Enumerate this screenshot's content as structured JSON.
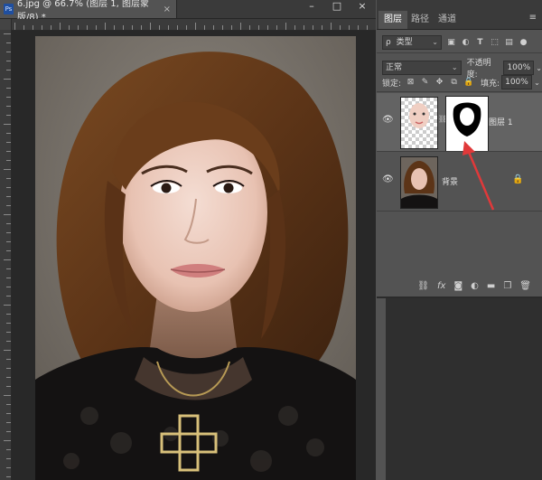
{
  "document": {
    "tab_title": "6.jpg @ 66.7% (图层 1, 图层蒙版/8) *",
    "ps_badge": "Ps",
    "close_glyph": "×"
  },
  "window": {
    "minimize": "–",
    "maximize": "□",
    "close": "×"
  },
  "panel": {
    "tabs": [
      {
        "label": "图层",
        "active": true
      },
      {
        "label": "路径",
        "active": false
      },
      {
        "label": "通道",
        "active": false
      }
    ],
    "menu_glyph": "≡",
    "filter": {
      "search_glyph": "ρ",
      "kind_label": "类型"
    },
    "filter_icons": [
      "image-filter-icon",
      "adjustment-filter-icon",
      "type-filter-icon",
      "shape-filter-icon",
      "smartobject-filter-icon",
      "toggle-filter-icon"
    ],
    "blend_mode": "正常",
    "opacity_label": "不透明度:",
    "opacity_value": "100%",
    "lock_label": "锁定:",
    "fill_label": "填充:",
    "fill_value": "100%",
    "layers": [
      {
        "name": "图层 1",
        "visible": true,
        "selected": true,
        "has_mask": true
      },
      {
        "name": "背景",
        "visible": true,
        "selected": false,
        "locked": true
      }
    ],
    "footer_icons": [
      "link-icon",
      "fx-icon",
      "add-mask-icon",
      "adjustment-icon",
      "group-icon",
      "new-layer-icon",
      "trash-icon"
    ],
    "footer_glyphs": [
      "⛓",
      "fx",
      "◙",
      "◐",
      "▬",
      "❐",
      "🗑"
    ]
  },
  "colors": {
    "ui_dark": "#2b2b2b",
    "ui_mid": "#535353",
    "selected_layer": "#636363",
    "arrow_red": "#e0393a",
    "ps_blue": "#1f4fa0"
  }
}
